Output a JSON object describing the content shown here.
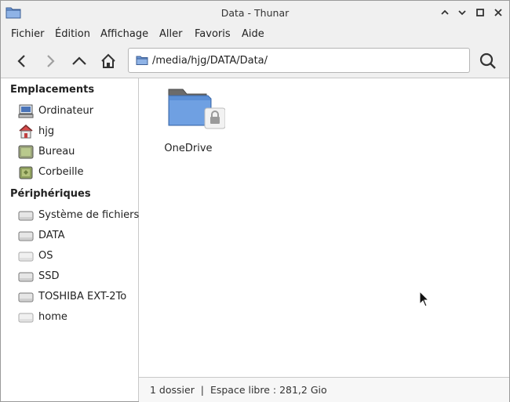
{
  "window": {
    "title": "Data - Thunar"
  },
  "menubar": {
    "items": [
      "Fichier",
      "Édition",
      "Affichage",
      "Aller",
      "Favoris",
      "Aide"
    ]
  },
  "toolbar": {
    "location_path": "/media/hjg/DATA/Data/"
  },
  "sidebar": {
    "places_heading": "Emplacements",
    "places": [
      {
        "label": "Ordinateur",
        "icon": "computer-icon"
      },
      {
        "label": "hjg",
        "icon": "home-folder-icon"
      },
      {
        "label": "Bureau",
        "icon": "desktop-icon"
      },
      {
        "label": "Corbeille",
        "icon": "trash-icon"
      }
    ],
    "devices_heading": "Périphériques",
    "devices": [
      {
        "label": "Système de fichiers",
        "icon": "drive-icon"
      },
      {
        "label": "DATA",
        "icon": "drive-icon"
      },
      {
        "label": "OS",
        "icon": "drive-icon"
      },
      {
        "label": "SSD",
        "icon": "drive-icon"
      },
      {
        "label": "TOSHIBA EXT-2To",
        "icon": "drive-icon"
      },
      {
        "label": "home",
        "icon": "drive-icon"
      }
    ]
  },
  "main": {
    "items": [
      {
        "name": "OneDrive",
        "icon": "locked-folder-icon"
      }
    ]
  },
  "statusbar": {
    "text": "1 dossier  |  Espace libre : 281,2 Gio"
  },
  "colors": {
    "folder_blue": "#5b8fd6",
    "chrome_bg": "#f0f0f0",
    "border": "#c8c8c8"
  }
}
